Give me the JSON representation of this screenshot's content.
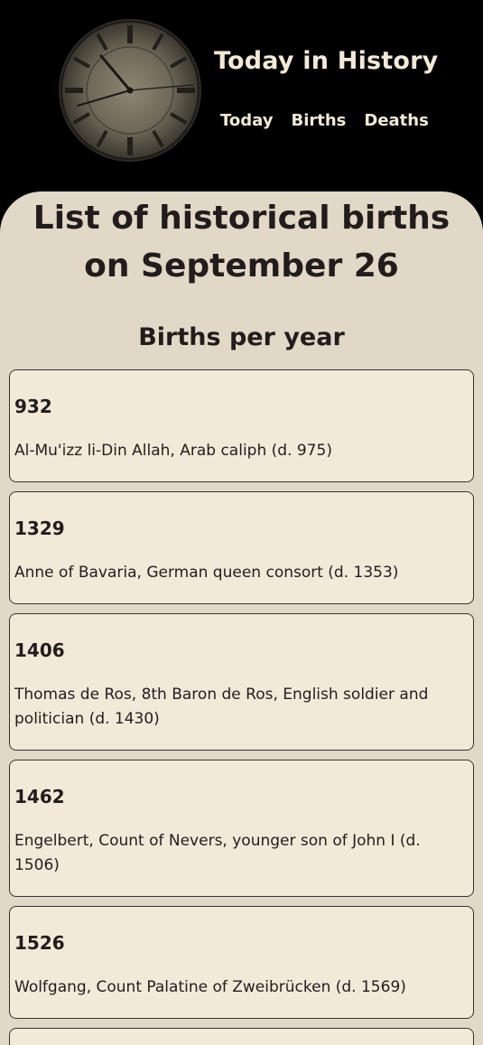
{
  "header": {
    "site_title": "Today in History",
    "logo_icon": "clock-icon",
    "nav": [
      {
        "label": "Today"
      },
      {
        "label": "Births"
      },
      {
        "label": "Deaths"
      }
    ]
  },
  "main": {
    "title": "List of historical births on September 26",
    "section_title": "Births per year",
    "entries": [
      {
        "year": "932",
        "description": "Al-Mu'izz li-Din Allah, Arab caliph (d. 975)"
      },
      {
        "year": "1329",
        "description": "Anne of Bavaria, German queen consort (d. 1353)"
      },
      {
        "year": "1406",
        "description": "Thomas de Ros, 8th Baron de Ros, English soldier and politician (d. 1430)"
      },
      {
        "year": "1462",
        "description": "Engelbert, Count of Nevers, younger son of John I (d. 1506)"
      },
      {
        "year": "1526",
        "description": "Wolfgang, Count Palatine of Zweibrücken (d. 1569)"
      }
    ]
  },
  "colors": {
    "header_bg": "#000000",
    "content_bg": "#e2d8c7",
    "card_bg": "#f3e9d9",
    "text": "#231c1c",
    "header_text": "#f2e9d8"
  }
}
